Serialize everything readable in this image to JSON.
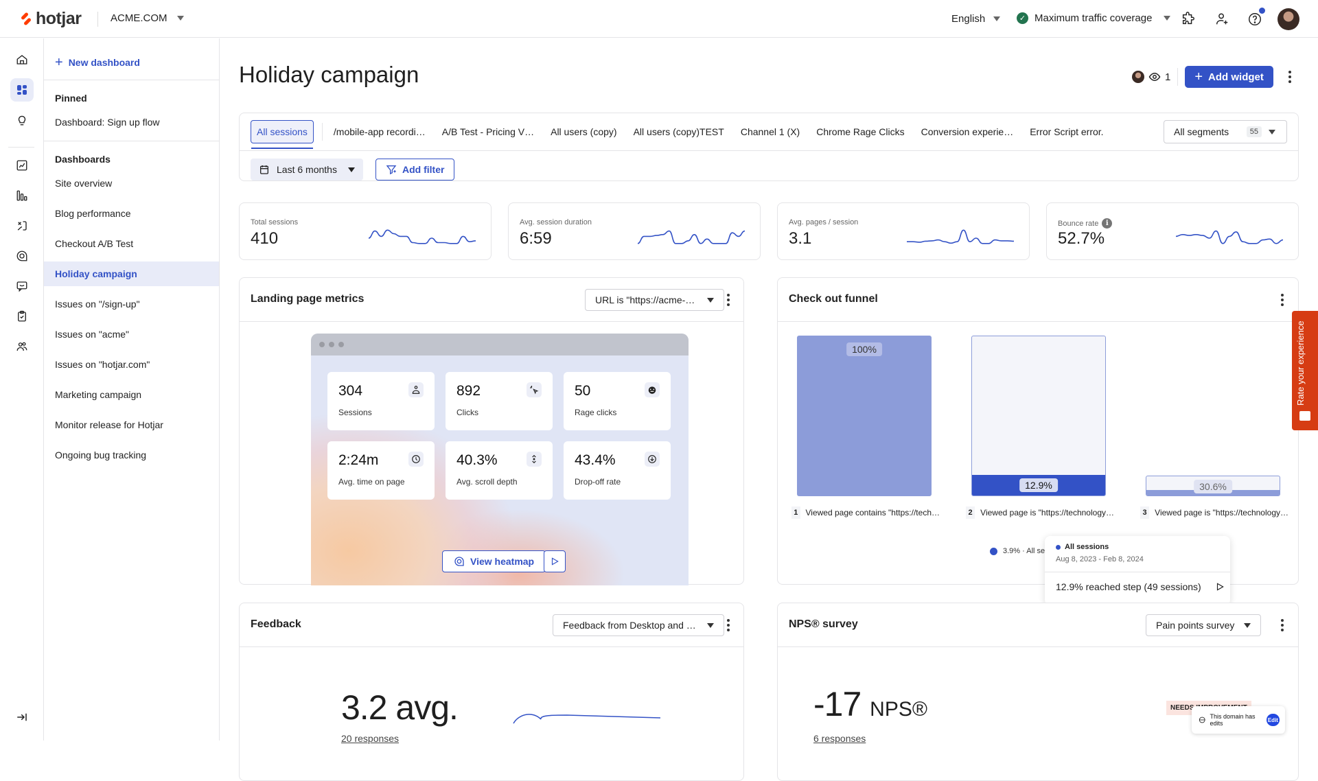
{
  "topbar": {
    "brand": "hotjar",
    "site": "ACME.COM",
    "language": "English",
    "coverage": "Maximum traffic coverage",
    "icons": [
      "integrations-icon",
      "invite-user-icon",
      "help-icon",
      "user-avatar"
    ]
  },
  "rail": {
    "items": [
      "home-icon",
      "dashboards-icon",
      "insights-icon",
      "trends-icon",
      "funnels-icon",
      "recordings-icon",
      "heatmaps-icon",
      "feedback-icon",
      "surveys-icon",
      "interviews-icon"
    ],
    "collapse": "collapse-sidebar-icon"
  },
  "nav": {
    "new_dashboard": "New dashboard",
    "pinned_heading": "Pinned",
    "pinned": [
      "Dashboard: Sign up flow"
    ],
    "dashboards_heading": "Dashboards",
    "dashboards": [
      "Site overview",
      "Blog performance",
      "Checkout A/B Test",
      "Holiday campaign",
      "Issues on \"/sign-up\"",
      "Issues on \"acme\"",
      "Issues on \"hotjar.com\"",
      "Marketing campaign",
      "Monitor release for Hotjar",
      "Ongoing bug tracking"
    ],
    "active": "Holiday campaign"
  },
  "header": {
    "title": "Holiday campaign",
    "viewers": "1",
    "add_widget": "Add widget"
  },
  "segments": {
    "tabs": [
      "All sessions",
      "/mobile-app recordi…",
      "A/B Test - Pricing V…",
      "All users (copy)",
      "All users (copy)TEST",
      "Channel 1 (X)",
      "Chrome Rage Clicks",
      "Conversion experie…",
      "Error Script error."
    ],
    "active": "All sessions",
    "all_segments": "All segments",
    "segment_count": "55",
    "date_range": "Last 6 months",
    "add_filter": "Add filter"
  },
  "kpis": [
    {
      "label": "Total sessions",
      "value": "410",
      "trend": [
        0.5,
        0.9,
        0.6,
        0.95,
        0.75,
        0.6,
        0.6,
        0.25,
        0.2,
        0.2,
        0.5,
        0.25,
        0.25,
        0.2,
        0.2,
        0.6,
        0.3,
        0.35
      ]
    },
    {
      "label": "Avg. session duration",
      "value": "6:59",
      "trend": [
        0.2,
        0.6,
        0.6,
        0.65,
        0.7,
        0.9,
        0.2,
        0.2,
        0.35,
        0.7,
        0.2,
        0.45,
        0.2,
        0.2,
        0.2,
        0.8,
        0.6,
        0.9
      ]
    },
    {
      "label": "Avg. pages / session",
      "value": "3.1",
      "trend": [
        0.3,
        0.3,
        0.27,
        0.33,
        0.35,
        0.4,
        0.3,
        0.22,
        0.3,
        0.95,
        0.3,
        0.5,
        0.2,
        0.2,
        0.4,
        0.35,
        0.35,
        0.33
      ]
    },
    {
      "label": "Bounce rate",
      "value": "52.7%",
      "info": true,
      "trend": [
        0.6,
        0.7,
        0.65,
        0.7,
        0.65,
        0.5,
        0.9,
        0.2,
        0.6,
        0.85,
        0.3,
        0.2,
        0.2,
        0.4,
        0.45,
        0.2,
        0.4
      ]
    }
  ],
  "landing_page": {
    "title": "Landing page metrics",
    "filter": "URL is \"https://acme-…",
    "metrics": [
      {
        "value": "304",
        "label": "Sessions",
        "icon": "users-icon"
      },
      {
        "value": "892",
        "label": "Clicks",
        "icon": "click-icon"
      },
      {
        "value": "50",
        "label": "Rage clicks",
        "icon": "rage-icon"
      },
      {
        "value": "2:24m",
        "label": "Avg. time on page",
        "icon": "clock-icon"
      },
      {
        "value": "40.3%",
        "label": "Avg. scroll depth",
        "icon": "scroll-icon"
      },
      {
        "value": "43.4%",
        "label": "Drop-off rate",
        "icon": "dropoff-icon"
      }
    ],
    "view_heatmap": "View heatmap"
  },
  "funnel": {
    "title": "Check out funnel",
    "steps": [
      {
        "num": "1",
        "label": "Viewed page contains \"https://tech…",
        "percent": 100,
        "percent_label": "100%"
      },
      {
        "num": "2",
        "label": "Viewed page is \"https://technology…",
        "percent": 12.9,
        "percent_label": "12.9%"
      },
      {
        "num": "3",
        "label": "Viewed page is \"https://technology…",
        "percent": 30.6,
        "percent_label": "30.6%"
      }
    ],
    "legend": "3.9% · All sessions",
    "tooltip": {
      "segment": "All sessions",
      "date": "Aug 8, 2023 - Feb 8, 2024",
      "body": "12.9% reached step (49 sessions)"
    }
  },
  "feedback": {
    "title": "Feedback",
    "filter": "Feedback from Desktop and …",
    "avg": "3.2 avg.",
    "responses": "20 responses"
  },
  "nps": {
    "title": "NPS® survey",
    "filter": "Pain points survey",
    "score": "-17",
    "unit": "NPS®",
    "responses": "6 responses",
    "badge": "NEEDS IMPROVEMENT"
  },
  "rate_tab": "Rate your experience",
  "domain_popup": {
    "text": "This domain has edits",
    "edit": "Edit"
  },
  "colors": {
    "accent": "#3352c6",
    "brand": "#ff3c00",
    "rate_tab": "#d63c13",
    "coverage_ok": "#23744f"
  }
}
